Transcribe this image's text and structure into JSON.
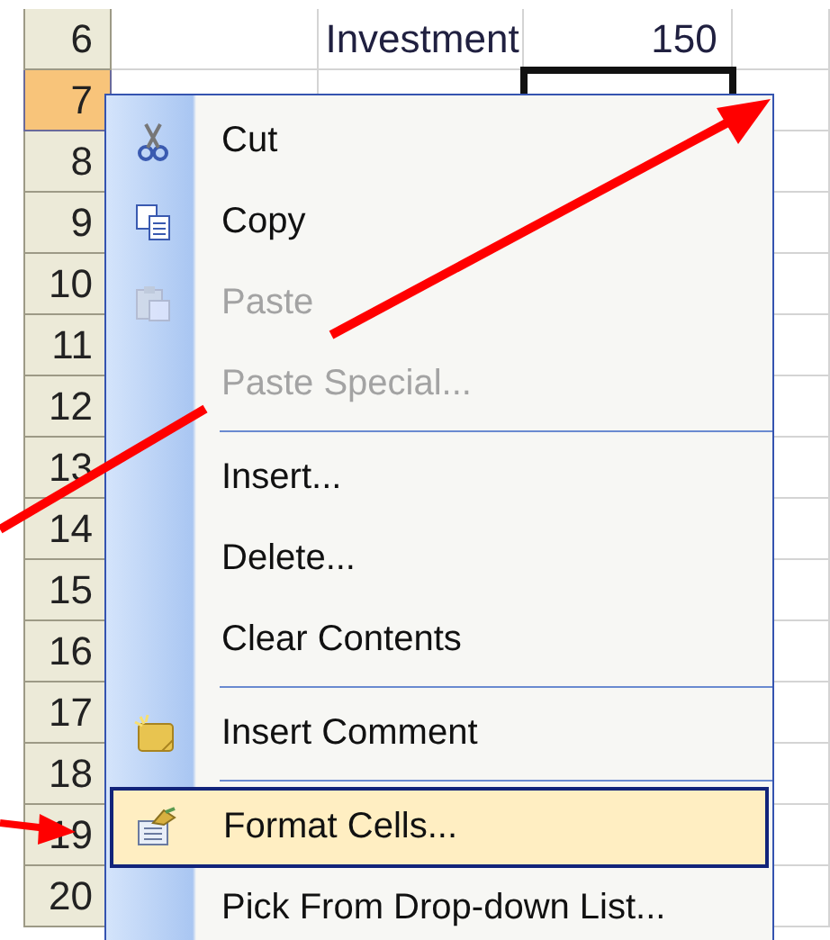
{
  "sheet": {
    "rows": [
      {
        "header": "6",
        "selected": false,
        "label": "Investment",
        "value": "150"
      },
      {
        "header": "7",
        "selected": true
      },
      {
        "header": "8",
        "selected": false
      },
      {
        "header": "9",
        "selected": false
      },
      {
        "header": "10",
        "selected": false
      },
      {
        "header": "11",
        "selected": false
      },
      {
        "header": "12",
        "selected": false
      },
      {
        "header": "13",
        "selected": false
      },
      {
        "header": "14",
        "selected": false
      },
      {
        "header": "15",
        "selected": false
      },
      {
        "header": "16",
        "selected": false
      },
      {
        "header": "17",
        "selected": false
      },
      {
        "header": "18",
        "selected": false
      },
      {
        "header": "19",
        "selected": false
      },
      {
        "header": "20",
        "selected": false
      }
    ]
  },
  "context_menu": {
    "items": [
      {
        "kind": "item",
        "label": "Cut",
        "disabled": false,
        "selected": false
      },
      {
        "kind": "item",
        "label": "Copy",
        "disabled": false,
        "selected": false
      },
      {
        "kind": "item",
        "label": "Paste",
        "disabled": true,
        "selected": false
      },
      {
        "kind": "item",
        "label": "Paste Special...",
        "disabled": true,
        "selected": false
      },
      {
        "kind": "separator"
      },
      {
        "kind": "item",
        "label": "Insert...",
        "disabled": false,
        "selected": false
      },
      {
        "kind": "item",
        "label": "Delete...",
        "disabled": false,
        "selected": false
      },
      {
        "kind": "item",
        "label": "Clear Contents",
        "disabled": false,
        "selected": false
      },
      {
        "kind": "separator"
      },
      {
        "kind": "item",
        "label": "Insert Comment",
        "disabled": false,
        "selected": false
      },
      {
        "kind": "separator"
      },
      {
        "kind": "item",
        "label": "Format Cells...",
        "disabled": false,
        "selected": true
      },
      {
        "kind": "item",
        "label": "Pick From Drop-down List...",
        "disabled": false,
        "selected": false
      }
    ]
  }
}
